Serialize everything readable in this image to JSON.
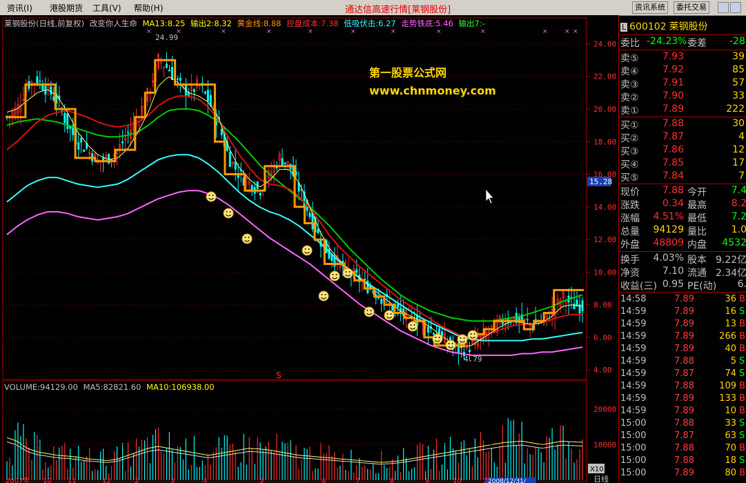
{
  "menu": {
    "items": [
      "资讯(I)",
      "港股期货",
      "工具(V)",
      "帮助(H)"
    ]
  },
  "app_title": "通达信高速行情",
  "stock_tag": "[莱钢股份]",
  "top_buttons": [
    "资讯系统",
    "委托交易"
  ],
  "legend": {
    "name": "莱钢股份(日线,前复权)",
    "indicator": "改变你人生命",
    "items": [
      {
        "label": "MA13:8.25",
        "color": "#ffff00"
      },
      {
        "label": "输出2:8.32",
        "color": "#ffff00"
      },
      {
        "label": "黄金线:8.88",
        "color": "#ff9900"
      },
      {
        "label": "控盘成本:7.38",
        "color": "#ff3030"
      },
      {
        "label": "低吸伏击:6.27",
        "color": "#33ffff"
      },
      {
        "label": "走势铁底:5.46",
        "color": "#ff66ff"
      },
      {
        "label": "输出7:-",
        "color": "#33ff33"
      }
    ]
  },
  "price_axis": [
    "24.00",
    "22.00",
    "20.00",
    "18.00",
    "16.00",
    "14.00",
    "12.00",
    "10.00",
    "8.00",
    "6.00",
    "4.00"
  ],
  "current_price_tag": "15.28",
  "high_label": "24.99",
  "low_label": "4.79",
  "watermark": {
    "line1": "第一股票公式网",
    "line2": "www.chnmoney.com"
  },
  "volume_legend": {
    "items": [
      {
        "label": "VOLUME:94129.00",
        "color": "#c0c0c0"
      },
      {
        "label": "MA5:82821.60",
        "color": "#c0c0c0"
      },
      {
        "label": "MA10:106938.00",
        "color": "#ffff00"
      }
    ]
  },
  "volume_axis": [
    "20000",
    "10000"
  ],
  "volume_unit": "X10",
  "date_axis": [
    "2007年",
    "10",
    "11",
    "12",
    "2",
    "3",
    "4",
    "5",
    "6",
    "7",
    "8",
    "9",
    "10",
    "11"
  ],
  "date_cursor": "2008/12/31/",
  "period_label": "日线",
  "stock": {
    "code": "600102",
    "name": "莱钢股份",
    "market": "L"
  },
  "orderbook": {
    "weibi_label": "委比",
    "weibi": "-24.23%",
    "weicha_label": "委差",
    "weicha": "-28",
    "sells": [
      {
        "label": "卖⑤",
        "price": "7.93",
        "vol": "39"
      },
      {
        "label": "卖④",
        "price": "7.92",
        "vol": "85"
      },
      {
        "label": "卖③",
        "price": "7.91",
        "vol": "57"
      },
      {
        "label": "卖②",
        "price": "7.90",
        "vol": "33"
      },
      {
        "label": "卖①",
        "price": "7.89",
        "vol": "222"
      }
    ],
    "buys": [
      {
        "label": "买①",
        "price": "7.88",
        "vol": "30"
      },
      {
        "label": "买②",
        "price": "7.87",
        "vol": "4"
      },
      {
        "label": "买③",
        "price": "7.86",
        "vol": "12"
      },
      {
        "label": "买④",
        "price": "7.85",
        "vol": "17"
      },
      {
        "label": "买⑤",
        "price": "7.84",
        "vol": "7"
      }
    ]
  },
  "quote": [
    {
      "l1": "现价",
      "v1": "7.88",
      "l2": "今开",
      "v2": "7.4"
    },
    {
      "l1": "涨跌",
      "v1": "0.34",
      "l2": "最高",
      "v2": "8.2"
    },
    {
      "l1": "涨幅",
      "v1": "4.51%",
      "l2": "最低",
      "v2": "7.2"
    },
    {
      "l1": "总量",
      "v1": "94129",
      "l2": "量比",
      "v2": "1.0"
    },
    {
      "l1": "外盘",
      "v1": "48809",
      "l2": "内盘",
      "v2": "4532"
    }
  ],
  "fund": [
    {
      "l1": "换手",
      "v1": "4.03%",
      "l2": "股本",
      "v2": "9.22亿"
    },
    {
      "l1": "净资",
      "v1": "7.10",
      "l2": "流通",
      "v2": "2.34亿"
    },
    {
      "l1": "收益(三)",
      "v1": "0.95",
      "l2": "PE(动)",
      "v2": "6."
    }
  ],
  "ticks": [
    {
      "t": "14:58",
      "p": "7.89",
      "v": "36",
      "s": "B"
    },
    {
      "t": "14:59",
      "p": "7.89",
      "v": "16",
      "s": "S"
    },
    {
      "t": "14:59",
      "p": "7.89",
      "v": "13",
      "s": "B"
    },
    {
      "t": "14:59",
      "p": "7.89",
      "v": "266",
      "s": "B"
    },
    {
      "t": "14:59",
      "p": "7.89",
      "v": "40",
      "s": "B"
    },
    {
      "t": "14:59",
      "p": "7.88",
      "v": "5",
      "s": "S"
    },
    {
      "t": "14:59",
      "p": "7.87",
      "v": "74",
      "s": "S"
    },
    {
      "t": "14:59",
      "p": "7.88",
      "v": "109",
      "s": "B"
    },
    {
      "t": "14:59",
      "p": "7.89",
      "v": "133",
      "s": "B"
    },
    {
      "t": "14:59",
      "p": "7.89",
      "v": "10",
      "s": "B"
    },
    {
      "t": "15:00",
      "p": "7.88",
      "v": "33",
      "s": "S"
    },
    {
      "t": "15:00",
      "p": "7.87",
      "v": "63",
      "s": "S"
    },
    {
      "t": "15:00",
      "p": "7.88",
      "v": "70",
      "s": "B"
    },
    {
      "t": "15:00",
      "p": "7.88",
      "v": "18",
      "s": "S"
    },
    {
      "t": "15:00",
      "p": "7.89",
      "v": "80",
      "s": "B"
    }
  ],
  "colors": {
    "up": "#ff3030",
    "down": "#00ffff",
    "sell_label": "#ff3030",
    "buy_label": "#ff3030",
    "green": "#00ff00"
  },
  "chart_data": {
    "type": "candlestick",
    "price_range": [
      3.5,
      25.5
    ],
    "close_series": [
      19.5,
      20.0,
      21.5,
      21.8,
      21.2,
      20.5,
      19.0,
      18.0,
      17.5,
      16.8,
      17.0,
      17.5,
      18.5,
      19.5,
      21.0,
      23.0,
      22.5,
      21.5,
      21.0,
      21.5,
      20.5,
      19.0,
      17.0,
      16.0,
      15.5,
      15.0,
      16.0,
      17.0,
      16.5,
      15.0,
      13.5,
      12.0,
      11.0,
      10.5,
      10.0,
      9.5,
      9.0,
      8.5,
      8.0,
      7.5,
      7.2,
      7.0,
      6.5,
      6.0,
      5.5,
      5.2,
      5.5,
      6.0,
      6.5,
      7.0,
      7.2,
      7.0,
      6.8,
      7.0,
      7.5,
      8.5,
      8.0,
      7.9
    ],
    "yellow_ma": [
      19.8,
      20.0,
      20.5,
      21.0,
      21.2,
      20.8,
      19.8,
      18.6,
      17.8,
      17.2,
      16.9,
      17.0,
      17.6,
      18.6,
      19.8,
      21.4,
      22.0,
      21.6,
      21.0,
      20.8,
      20.4,
      19.4,
      17.6,
      16.4,
      15.7,
      15.2,
      15.6,
      16.3,
      16.3,
      15.4,
      14.0,
      12.5,
      11.4,
      10.7,
      10.1,
      9.6,
      9.1,
      8.6,
      8.1,
      7.6,
      7.3,
      7.0,
      6.6,
      6.1,
      5.7,
      5.4,
      5.5,
      5.9,
      6.3,
      6.7,
      7.0,
      6.9,
      6.8,
      6.9,
      7.3,
      7.9,
      8.0,
      7.9
    ],
    "gold_line": [
      19.5,
      19.5,
      21.5,
      21.5,
      21.5,
      20.0,
      20.0,
      17.0,
      17.0,
      16.8,
      16.8,
      17.5,
      17.5,
      19.5,
      21.0,
      23.0,
      23.0,
      21.5,
      21.5,
      21.5,
      21.5,
      18.0,
      16.0,
      16.0,
      15.0,
      15.0,
      16.5,
      16.5,
      16.5,
      14.0,
      13.0,
      12.0,
      10.5,
      10.5,
      10.0,
      9.5,
      9.0,
      8.5,
      8.0,
      7.5,
      7.2,
      7.0,
      6.0,
      5.5,
      5.5,
      5.5,
      6.0,
      6.2,
      6.5,
      7.0,
      7.0,
      7.0,
      6.5,
      7.0,
      7.5,
      8.9,
      8.9,
      8.9
    ],
    "control_cost": [
      17.5,
      18.0,
      18.6,
      19.2,
      19.6,
      19.8,
      19.9,
      19.7,
      19.5,
      19.2,
      19.0,
      18.9,
      19.0,
      19.2,
      19.6,
      20.2,
      20.6,
      20.8,
      20.8,
      20.6,
      20.1,
      19.3,
      18.2,
      17.2,
      16.4,
      15.7,
      15.4,
      15.3,
      15.1,
      14.6,
      13.9,
      13.1,
      12.2,
      11.5,
      10.9,
      10.3,
      9.8,
      9.3,
      8.8,
      8.3,
      7.9,
      7.5,
      7.1,
      6.7,
      6.4,
      6.1,
      6.0,
      6.1,
      6.3,
      6.5,
      6.7,
      6.8,
      6.8,
      6.9,
      7.1,
      7.3,
      7.4,
      7.4
    ],
    "green_ma": [
      19.0,
      19.2,
      19.3,
      19.4,
      19.3,
      19.2,
      19.0,
      18.8,
      18.6,
      18.4,
      18.3,
      18.3,
      18.4,
      18.6,
      19.0,
      19.5,
      19.9,
      20.0,
      20.0,
      19.9,
      19.6,
      19.2,
      18.6,
      18.0,
      17.3,
      16.6,
      16.0,
      15.5,
      15.0,
      14.5,
      14.0,
      13.4,
      12.8,
      12.1,
      11.4,
      10.8,
      10.2,
      9.6,
      9.1,
      8.6,
      8.2,
      7.9,
      7.6,
      7.4,
      7.2,
      7.1,
      7.0,
      7.0,
      7.0,
      7.1,
      7.2,
      7.3,
      7.5,
      7.7,
      7.9,
      8.2,
      8.4,
      8.6
    ],
    "cyan_ma": [
      14.3,
      14.8,
      15.3,
      15.6,
      15.8,
      15.8,
      15.6,
      15.4,
      15.3,
      15.2,
      15.3,
      15.4,
      15.7,
      16.1,
      16.5,
      16.9,
      17.1,
      17.2,
      17.2,
      17.0,
      16.6,
      16.1,
      15.5,
      14.9,
      14.4,
      14.0,
      13.7,
      13.5,
      13.2,
      12.8,
      12.3,
      11.8,
      11.2,
      10.6,
      10.1,
      9.6,
      9.2,
      8.8,
      8.4,
      8.0,
      7.6,
      7.2,
      6.9,
      6.6,
      6.3,
      6.0,
      5.9,
      5.8,
      5.8,
      5.8,
      5.8,
      5.8,
      5.9,
      5.9,
      6.0,
      6.1,
      6.2,
      6.3
    ],
    "pink_ma": [
      12.3,
      12.8,
      13.2,
      13.5,
      13.7,
      13.7,
      13.6,
      13.4,
      13.3,
      13.2,
      13.3,
      13.4,
      13.6,
      13.9,
      14.2,
      14.5,
      14.7,
      14.9,
      15.0,
      15.0,
      14.8,
      14.5,
      14.1,
      13.6,
      13.1,
      12.6,
      12.1,
      11.7,
      11.3,
      10.9,
      10.5,
      10.0,
      9.5,
      9.0,
      8.5,
      8.0,
      7.6,
      7.2,
      6.8,
      6.4,
      6.1,
      5.8,
      5.5,
      5.3,
      5.1,
      5.0,
      4.9,
      4.9,
      4.9,
      4.9,
      4.9,
      5.0,
      5.0,
      5.1,
      5.1,
      5.2,
      5.3,
      5.4
    ],
    "volume_range": [
      0,
      26000
    ],
    "volume_ma10": [
      12000,
      11000,
      9000,
      8000,
      7500,
      7000,
      6800,
      6500,
      6000,
      5800,
      5500,
      6000,
      7000,
      8000,
      9000,
      9500,
      9000,
      8500,
      8000,
      7500,
      7000,
      7500,
      8000,
      8500,
      9000,
      8800,
      8500,
      8000,
      7500,
      7000,
      6800,
      6500,
      6300,
      6000,
      5800,
      5500,
      5300,
      5000,
      5200,
      5500,
      6000,
      6500,
      7000,
      7500,
      8000,
      8500,
      9000,
      9500,
      10000,
      10500,
      10800,
      11000,
      10500,
      10000,
      10500,
      11000,
      10800,
      10700
    ]
  }
}
